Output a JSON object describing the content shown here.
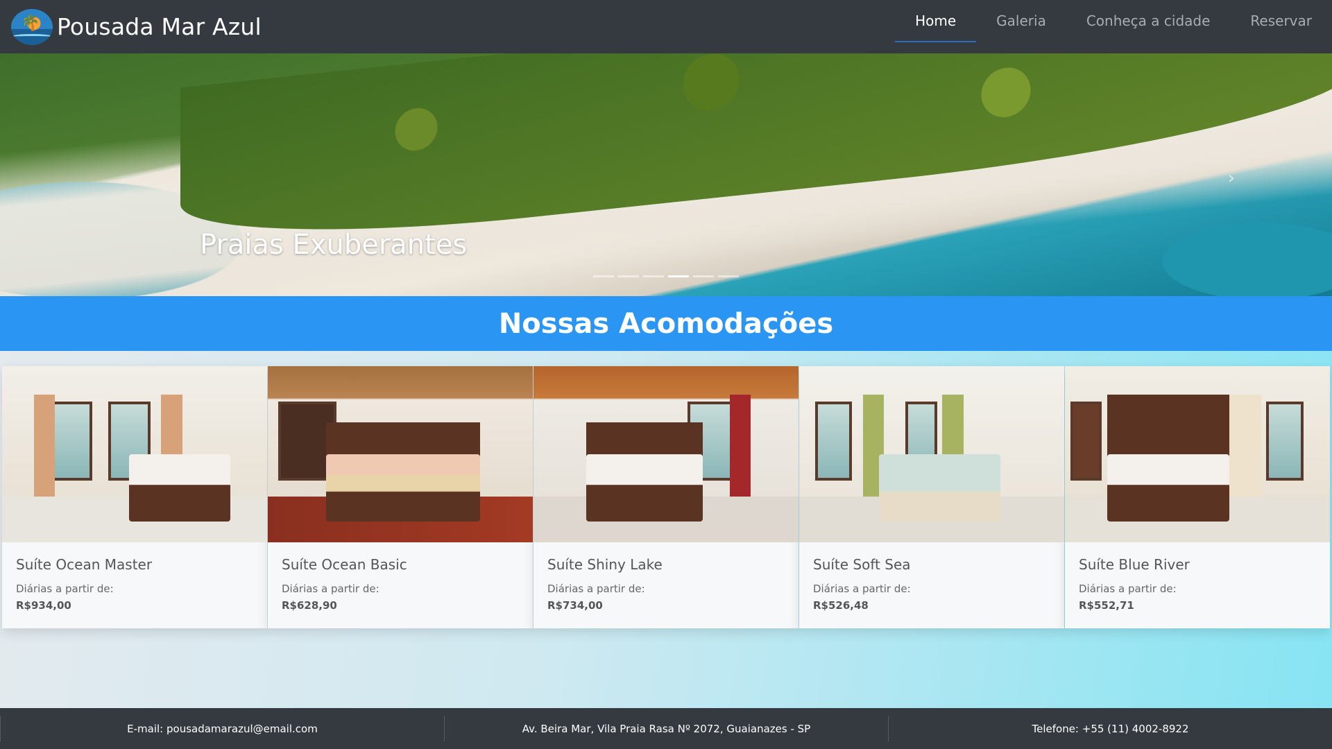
{
  "navbar": {
    "brand": "Pousada Mar Azul",
    "logo_icon": "beach-palm-logo-icon",
    "items": [
      {
        "label": "Home",
        "active": true
      },
      {
        "label": "Galeria",
        "active": false
      },
      {
        "label": "Conheça a cidade",
        "active": false
      },
      {
        "label": "Reservar",
        "active": false
      }
    ]
  },
  "hero": {
    "caption": "Praias Exuberantes",
    "slide_count": 6,
    "active_slide": 4
  },
  "section": {
    "title": "Nossas Acomodações"
  },
  "rooms": [
    {
      "name": "Suíte Ocean Master",
      "price_label": "Diárias a partir de:",
      "price": "R$934,00"
    },
    {
      "name": "Suíte Ocean Basic",
      "price_label": "Diárias a partir de:",
      "price": "R$628,90"
    },
    {
      "name": "Suíte Shiny Lake",
      "price_label": "Diárias a partir de:",
      "price": "R$734,00"
    },
    {
      "name": "Suíte Soft Sea",
      "price_label": "Diárias a partir de:",
      "price": "R$526,48"
    },
    {
      "name": "Suíte Blue River",
      "price_label": "Diárias a partir de:",
      "price": "R$552,71"
    }
  ],
  "footer": {
    "email": "E-mail: pousadamarazul@email.com",
    "address": "Av. Beira Mar, Vila Praia Rasa Nº 2072, Guaianazes - SP",
    "phone": "Telefone: +55 (11) 4002-8922"
  },
  "colors": {
    "navbar_bg": "#343a40",
    "section_bg": "#2a95f3",
    "active_underline": "#2a6ebd"
  }
}
